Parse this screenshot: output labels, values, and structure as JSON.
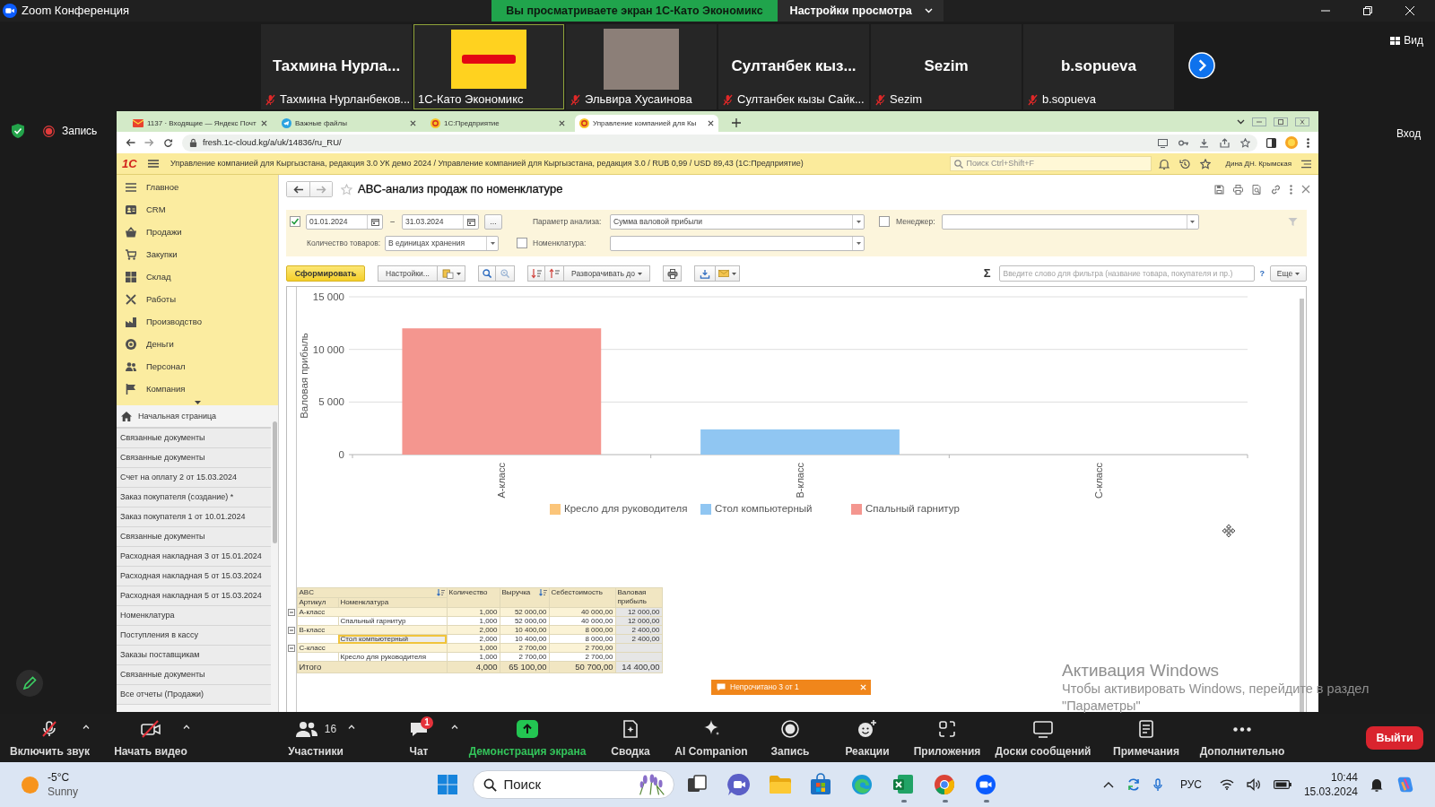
{
  "zoom_window": {
    "title": "Zoom Конференция",
    "share_banner": "Вы просматриваете экран 1С-Като Экономикс",
    "view_settings": "Настройки просмотра",
    "view_button": "Вид",
    "recording": "Запись",
    "sign_in": "Вход"
  },
  "participants": [
    {
      "kind": "name",
      "name": "Тахмина Нурла...",
      "caption": "Тахмина Нурланбеков...",
      "muted": true,
      "highlighted": false
    },
    {
      "kind": "logo",
      "caption": "1С-Като Экономикс",
      "muted": false,
      "highlighted": true
    },
    {
      "kind": "photo",
      "caption": "Эльвира Хусаинова",
      "muted": true,
      "highlighted": false
    },
    {
      "kind": "name",
      "name": "Султанбек кыз...",
      "caption": "Султанбек кызы Сайк...",
      "muted": true,
      "highlighted": false
    },
    {
      "kind": "name",
      "name": "Sezim",
      "caption": "Sezim",
      "muted": true,
      "highlighted": false
    },
    {
      "kind": "name",
      "name": "b.sopueva",
      "caption": "b.sopueva",
      "muted": true,
      "highlighted": false
    }
  ],
  "browser": {
    "tabs": [
      {
        "title": "1137 · Входящие — Яндекс Почт",
        "kind": "mail",
        "selected": false
      },
      {
        "title": "Важные файлы",
        "kind": "telegram",
        "selected": false
      },
      {
        "title": "1С:Предприятие",
        "kind": "onec",
        "selected": false
      },
      {
        "title": "Управление компанией для Кы",
        "kind": "onec",
        "selected": true
      }
    ],
    "url": "fresh.1c-cloud.kg/a/uk/14836/ru_RU/"
  },
  "app": {
    "logo": "1С",
    "title": "Управление компанией для Кыргызстана, редакция 3.0 УК демо 2024 / Управление компанией для Кыргызстана, редакция 3.0 / RUB 0,99 / USD 89,43  (1С:Предприятие)",
    "search_placeholder": "Поиск Ctrl+Shift+F",
    "user": "Дина ДН. Крымская"
  },
  "sections": [
    {
      "label": "Главное",
      "kind": "menu"
    },
    {
      "label": "CRM",
      "kind": "crm"
    },
    {
      "label": "Продажи",
      "kind": "sales"
    },
    {
      "label": "Закупки",
      "kind": "purchases"
    },
    {
      "label": "Склад",
      "kind": "warehouse"
    },
    {
      "label": "Работы",
      "kind": "works"
    },
    {
      "label": "Производство",
      "kind": "production"
    },
    {
      "label": "Деньги",
      "kind": "money"
    },
    {
      "label": "Персонал",
      "kind": "staff"
    },
    {
      "label": "Компания",
      "kind": "company"
    }
  ],
  "history": {
    "home": "Начальная страница",
    "items": [
      "Связанные документы",
      "Связанные документы",
      "Счет на оплату 2 от 15.03.2024",
      "Заказ покупателя (создание) *",
      "Заказ покупателя 1 от 10.01.2024",
      "Связанные документы",
      "Расходная накладная 3 от 15.01.2024",
      "Расходная накладная 5 от 15.03.2024",
      "Расходная накладная 5 от 15.03.2024",
      "Номенклатура",
      "Поступления в кассу",
      "Заказы поставщикам",
      "Связанные документы",
      "Все отчеты (Продажи)"
    ]
  },
  "report": {
    "title": "ABC-анализ продаж по номенклатуре",
    "filters": {
      "period_enabled": true,
      "date_from": "01.01.2024",
      "period_separator": "–",
      "date_to": "31.03.2024",
      "period_button": "...",
      "analysis_label": "Параметр анализа:",
      "analysis_value": "Сумма валовой прибыли",
      "manager_enabled": false,
      "manager_label": "Менеджер:",
      "quantity_label": "Количество товаров:",
      "quantity_value": "В единицах хранения",
      "nomenclature_enabled": false,
      "nomenclature_label": "Номенклатура:"
    },
    "toolbar": {
      "generate": "Сформировать",
      "settings": "Настройки...",
      "expand": "Разворачивать до",
      "sum": "Σ",
      "filter_placeholder": "Введите слово для фильтра (название товара, покупателя и пр.)",
      "help": "?",
      "more": "Еще"
    },
    "chart_data": {
      "type": "bar",
      "ylabel": "Валовая прибыль",
      "categories": [
        "A-класс",
        "B-класс",
        "C-класс"
      ],
      "series": [
        {
          "name": "Кресло для руководителя",
          "color": "#fbc57a",
          "values": [
            null,
            null,
            null
          ]
        },
        {
          "name": "Стол компьютерный",
          "color": "#90c6f2",
          "values": [
            null,
            2400,
            null
          ]
        },
        {
          "name": "Спальный гарнитур",
          "color": "#f4968f",
          "values": [
            12000,
            null,
            null
          ]
        }
      ],
      "stacked": true,
      "ylim": [
        0,
        15000
      ],
      "yticks": [
        {
          "value": 0,
          "label": "0"
        },
        {
          "value": 5000,
          "label": "5 000"
        },
        {
          "value": 10000,
          "label": "10 000"
        },
        {
          "value": 15000,
          "label": "15 000"
        }
      ],
      "legend": "bottom"
    },
    "table": {
      "columns": [
        {
          "label": "ABC",
          "sorted": true
        },
        {
          "label": "Количество",
          "sorted": false
        },
        {
          "label": "Выручка",
          "sorted": true
        },
        {
          "label": "Себестоимость",
          "sorted": false
        },
        {
          "label": "Валовая прибыль",
          "sorted": false
        }
      ],
      "subcolumns": [
        "Артикул",
        "Номенклатура"
      ],
      "groups": [
        {
          "name": "A-класс",
          "expanded": true,
          "quantity": "1,000",
          "revenue": "52 000,00",
          "cost": "40 000,00",
          "gross_profit": "12 000,00",
          "children": [
            {
              "name": "Спальный гарнитур",
              "selected": false,
              "quantity": "1,000",
              "revenue": "52 000,00",
              "cost": "40 000,00",
              "gross_profit": "12 000,00"
            }
          ]
        },
        {
          "name": "B-класс",
          "expanded": true,
          "quantity": "2,000",
          "revenue": "10 400,00",
          "cost": "8 000,00",
          "gross_profit": "2 400,00",
          "children": [
            {
              "name": "Стол компьютерный",
              "selected": true,
              "quantity": "2,000",
              "revenue": "10 400,00",
              "cost": "8 000,00",
              "gross_profit": "2 400,00"
            }
          ]
        },
        {
          "name": "C-класс",
          "expanded": true,
          "quantity": "1,000",
          "revenue": "2 700,00",
          "cost": "2 700,00",
          "children": [
            {
              "name": "Кресло для руководителя",
              "selected": false,
              "quantity": "1,000",
              "revenue": "2 700,00",
              "cost": "2 700,00"
            }
          ]
        }
      ],
      "total": {
        "label": "Итого",
        "quantity": "4,000",
        "revenue": "65 100,00",
        "cost": "50 700,00",
        "gross_profit": "14 400,00"
      }
    },
    "notification": "Непрочитано 3 от 1"
  },
  "windows_activation": {
    "title": "Активация Windows",
    "text": "Чтобы активировать Windows, перейдите в раздел \"Параметры\""
  },
  "zoom_toolbar": {
    "items": [
      {
        "kind": "mic",
        "label": "Включить звук",
        "caret": true,
        "active": false
      },
      {
        "kind": "video",
        "label": "Начать видео",
        "caret": true,
        "active": false
      },
      {
        "kind": "participants",
        "label": "Участники",
        "count": "16",
        "caret": true,
        "active": false
      },
      {
        "kind": "chat",
        "label": "Чат",
        "badge": "1",
        "caret": true,
        "active": false
      },
      {
        "kind": "share",
        "label": "Демонстрация экрана",
        "caret": false,
        "active": true
      },
      {
        "kind": "summary",
        "label": "Сводка",
        "caret": false,
        "active": false
      },
      {
        "kind": "ai",
        "label": "AI Companion",
        "caret": false,
        "active": false
      },
      {
        "kind": "record",
        "label": "Запись",
        "caret": false,
        "active": false
      },
      {
        "kind": "reactions",
        "label": "Реакции",
        "caret": false,
        "active": false
      },
      {
        "kind": "apps",
        "label": "Приложения",
        "caret": false,
        "active": false
      },
      {
        "kind": "boards",
        "label": "Доски сообщений",
        "caret": false,
        "active": false
      },
      {
        "kind": "notes",
        "label": "Примечания",
        "caret": false,
        "active": false
      },
      {
        "kind": "more",
        "label": "Дополнительно",
        "caret": false,
        "active": false
      }
    ],
    "leave": "Выйти"
  },
  "taskbar": {
    "weather": {
      "temperature": "-5°C",
      "condition": "Sunny"
    },
    "search_placeholder": "Поиск",
    "apps": [
      {
        "kind": "task_view",
        "running": false
      },
      {
        "kind": "meet",
        "running": false
      },
      {
        "kind": "explorer",
        "running": false
      },
      {
        "kind": "store",
        "running": false
      },
      {
        "kind": "edge",
        "running": false
      },
      {
        "kind": "excel",
        "running": true
      },
      {
        "kind": "chrome",
        "running": true
      },
      {
        "kind": "zoom",
        "running": true
      }
    ],
    "language": "РУС",
    "time": "10:44",
    "date": "15.03.2024"
  }
}
